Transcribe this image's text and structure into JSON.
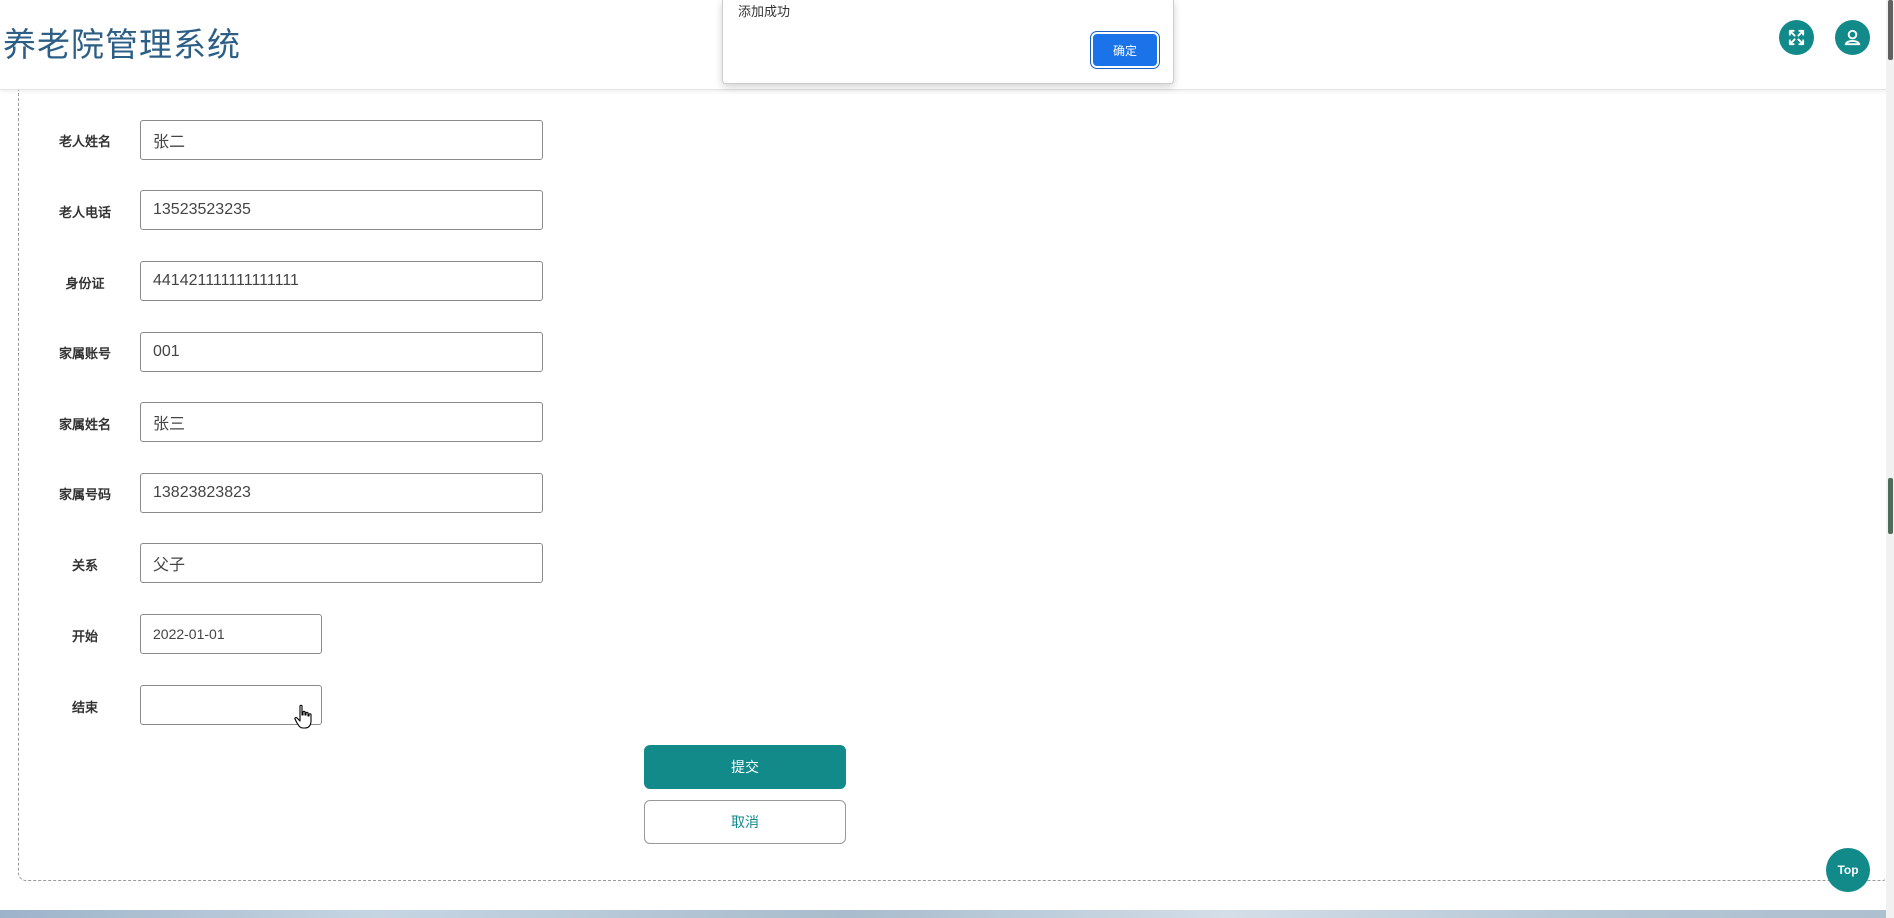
{
  "header": {
    "app_title": "养老院管理系统",
    "icons": [
      "fullscreen-icon",
      "user-icon"
    ]
  },
  "alert": {
    "message": "添加成功",
    "ok_label": "确定"
  },
  "form": {
    "fields": [
      {
        "label": "老人姓名",
        "value": "张二"
      },
      {
        "label": "老人电话",
        "value": "13523523235"
      },
      {
        "label": "身份证",
        "value": "441421111111111111"
      },
      {
        "label": "家属账号",
        "value": "001"
      },
      {
        "label": "家属姓名",
        "value": "张三"
      },
      {
        "label": "家属号码",
        "value": "13823823823"
      },
      {
        "label": "关系",
        "value": "父子"
      },
      {
        "label": "开始",
        "value": "2022-01-01"
      },
      {
        "label": "结束",
        "value": ""
      }
    ],
    "submit_label": "提交",
    "cancel_label": "取消"
  },
  "top_button_label": "Top",
  "colors": {
    "accent": "#128a8a",
    "title": "#2d5f86",
    "dialog_button": "#1a73e8"
  }
}
